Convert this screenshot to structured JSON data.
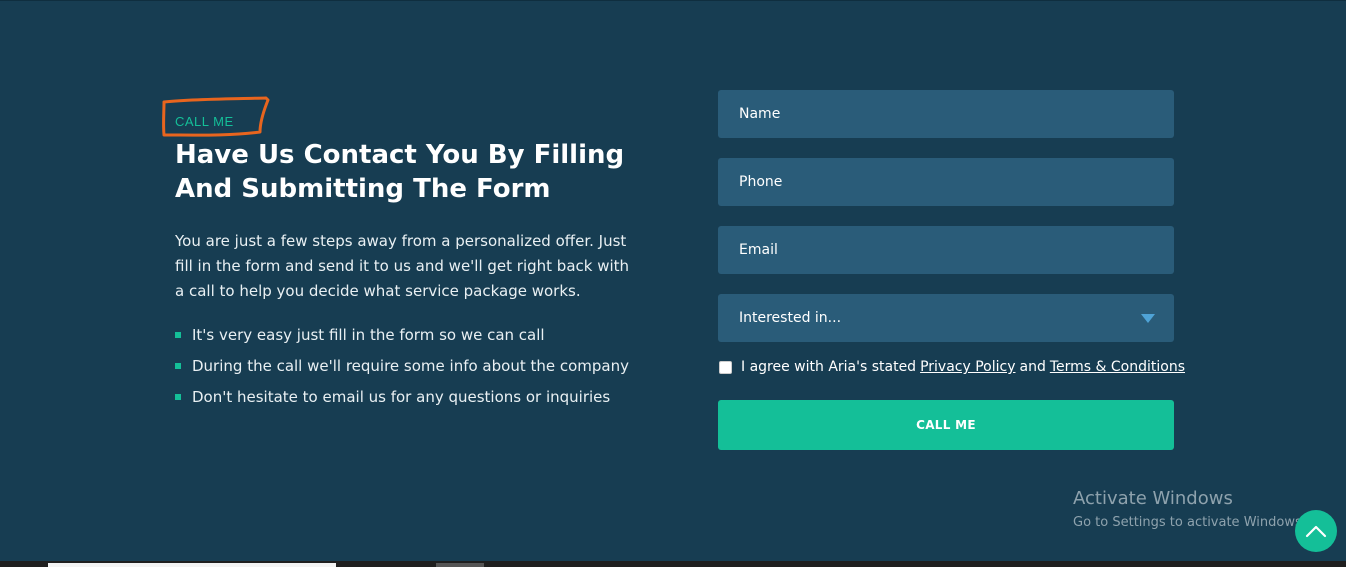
{
  "intro_section": {
    "eyebrow": "CALL ME",
    "heading": "Have Us Contact You By Filling And Submitting The Form",
    "paragraph": "You are just a few steps away from a personalized offer. Just fill in the form and send it to us and we'll get right back with a call to help you decide what service package works.",
    "bullets": [
      "It's very easy just fill in the form so we can call",
      "During the call we'll require some info about the company",
      "Don't hesitate to email us for any questions or inquiries"
    ]
  },
  "form": {
    "name_placeholder": "Name",
    "phone_placeholder": "Phone",
    "email_placeholder": "Email",
    "interest_selected": "Interested in...",
    "agree_text": "I agree with Aria's stated",
    "privacy_link": "Privacy Policy",
    "and_text": "and",
    "terms_link": "Terms & Conditions",
    "submit_label": "CALL ME"
  },
  "watermark": {
    "title": "Activate Windows",
    "subtitle": "Go to Settings to activate Windows."
  },
  "icons": {
    "scroll_top": "chevron-up-icon",
    "dropdown": "caret-down-icon",
    "bullet": "square-bullet-icon"
  },
  "colors": {
    "background": "#173d52",
    "field": "#2a5c79",
    "accent": "#14bf98",
    "annotation": "#e8651e"
  }
}
